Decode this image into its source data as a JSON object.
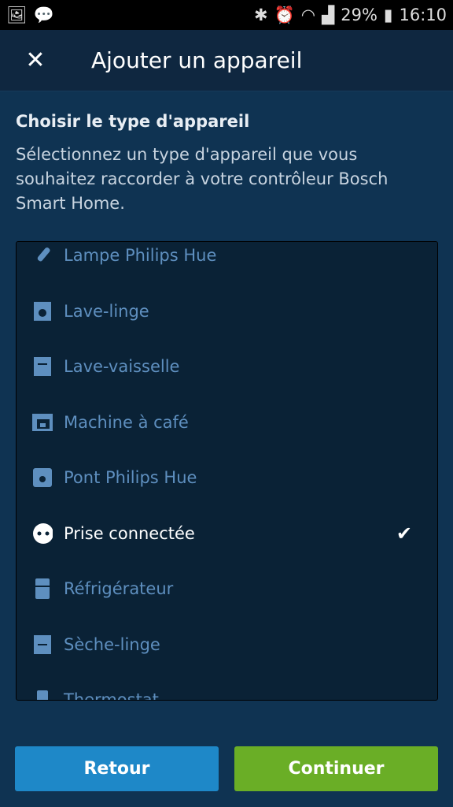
{
  "status": {
    "battery": "29%",
    "time": "16:10"
  },
  "appbar": {
    "title": "Ajouter un appareil"
  },
  "heading": "Choisir le type d'appareil",
  "description": "Sélectionnez un type d'appareil que vous souhaitez raccorder à votre contrôleur Bosch Smart Home.",
  "devices": [
    {
      "label": "Lampe Philips Hue",
      "icon": "lamp-icon"
    },
    {
      "label": "Lave-linge",
      "icon": "washing-machine-icon"
    },
    {
      "label": "Lave-vaisselle",
      "icon": "dishwasher-icon"
    },
    {
      "label": "Machine à café",
      "icon": "coffee-machine-icon"
    },
    {
      "label": "Pont Philips Hue",
      "icon": "hue-bridge-icon"
    },
    {
      "label": "Prise connectée",
      "icon": "smart-plug-icon",
      "selected": true
    },
    {
      "label": "Réfrigérateur",
      "icon": "fridge-icon"
    },
    {
      "label": "Sèche-linge",
      "icon": "dryer-icon"
    },
    {
      "label": "Thermostat",
      "icon": "thermostat-icon"
    }
  ],
  "buttons": {
    "back": "Retour",
    "next": "Continuer"
  },
  "colors": {
    "back": "#1e88c8",
    "next": "#6aae26",
    "item": "#5e8fbf"
  }
}
